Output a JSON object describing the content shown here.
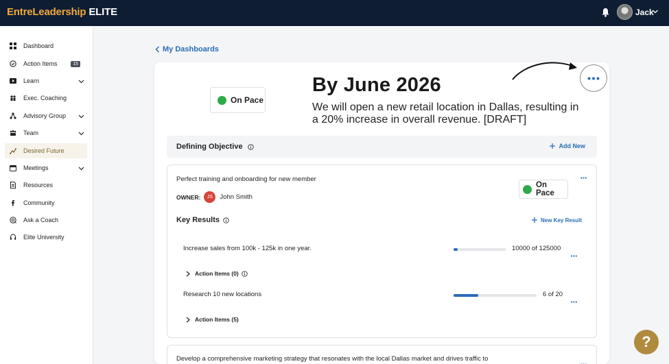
{
  "header": {
    "brand_primary": "EntreLeadership",
    "brand_secondary": "ELITE",
    "user_name": "Jack"
  },
  "sidebar": {
    "items": [
      {
        "label": "Dashboard",
        "icon": "grid-icon"
      },
      {
        "label": "Action Items",
        "icon": "check-circle-icon",
        "badge": "15"
      },
      {
        "label": "Learn",
        "icon": "play-icon"
      },
      {
        "label": "Exec. Coaching",
        "icon": "people-icon"
      },
      {
        "label": "Advisory Group",
        "icon": "network-icon"
      },
      {
        "label": "Team",
        "icon": "team-icon"
      },
      {
        "label": "Desired Future",
        "icon": "target-icon",
        "active": true
      },
      {
        "label": "Meetings",
        "icon": "calendar-icon"
      },
      {
        "label": "Resources",
        "icon": "document-icon"
      },
      {
        "label": "Community",
        "icon": "facebook-icon"
      },
      {
        "label": "Ask a Coach",
        "icon": "chat-icon"
      },
      {
        "label": "Elite University",
        "icon": "headset-icon"
      }
    ]
  },
  "breadcrumb": {
    "back_label": "My Dashboards"
  },
  "goal": {
    "status": "On Pace",
    "title": "By June 2026",
    "description": "We will open a new retail location in Dallas, resulting in a 20% increase in overall revenue. [DRAFT]"
  },
  "objective_section": {
    "title": "Defining Objective",
    "add_label": "Add New"
  },
  "objective": {
    "title": "Perfect training and onboarding for new member",
    "owner_label": "OWNER:",
    "owner_initials": "JS",
    "owner_name": "John Smith",
    "status": "On Pace",
    "key_results_title": "Key Results",
    "new_key_result_label": "New Key Result",
    "key_results": [
      {
        "title": "Increase sales from 100k - 125k in one year.",
        "progress_text": "10000 of 125000",
        "progress": 0.08,
        "action_items_label": "Action Items (0)"
      },
      {
        "title": "Research 10 new locations",
        "progress_text": "6 of 20",
        "progress": 0.3,
        "action_items_label": "Action Items (5)"
      }
    ]
  },
  "objective2": {
    "title": "Develop a comprehensive marketing strategy that resonates with the local Dallas market and drives traffic to"
  },
  "colors": {
    "header_bg": "#0f1d33",
    "brand_orange": "#f2a93b",
    "link_blue": "#2a6db6",
    "status_green": "#2eaa4a",
    "help_gold": "#b08a3e"
  }
}
